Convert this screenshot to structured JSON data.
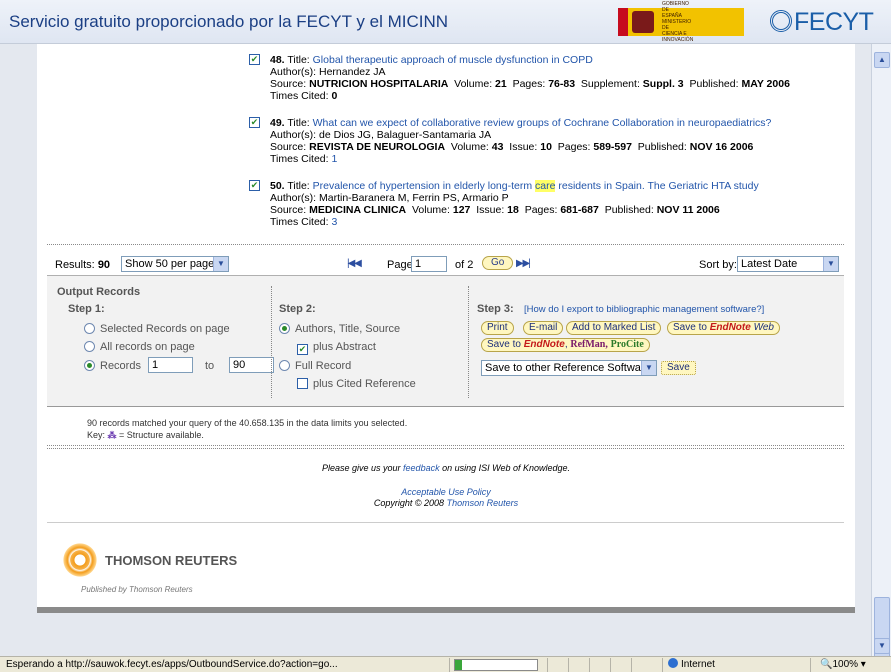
{
  "header": {
    "site_title": "Servicio gratuito proporcionado por la FECYT y el MICINN",
    "gov_logo_text": "GOBIERNO DE ESPAÑA  MINISTERIO DE CIENCIA E INNOVACIÓN",
    "fecyt_logo": "FECYT"
  },
  "records": [
    {
      "number": "48.",
      "title_label": "Title:",
      "title": "Global therapeutic approach of muscle dysfunction in COPD",
      "authors": "Author(s): Hernandez JA",
      "source_label": "Source:",
      "source": "NUTRICION HOSPITALARIA",
      "volume_label": "Volume:",
      "volume": "21",
      "issue_label": "",
      "issue": "",
      "pages_label": "Pages:",
      "pages": "76-83",
      "supplement_label": "Supplement:",
      "supplement": "Suppl. 3",
      "published_label": "Published:",
      "published": "MAY 2006",
      "times_cited_label": "Times Cited:",
      "times_cited": "0",
      "checked": true
    },
    {
      "number": "49.",
      "title_label": "Title:",
      "title": "What can we expect of collaborative review groups of Cochrane Collaboration in neuropaediatrics?",
      "authors": "Author(s): de Dios JG, Balaguer-Santamaria JA",
      "source_label": "Source:",
      "source": "REVISTA DE NEUROLOGIA",
      "volume_label": "Volume:",
      "volume": "43",
      "issue_label": "Issue:",
      "issue": "10",
      "pages_label": "Pages:",
      "pages": "589-597",
      "published_label": "Published:",
      "published": "NOV 16 2006",
      "times_cited_label": "Times Cited:",
      "times_cited": "1",
      "checked": true
    },
    {
      "number": "50.",
      "title_label": "Title:",
      "title_part1": "Prevalence of hypertension in elderly long-term ",
      "title_highlight": "care",
      "title_part2": " residents in Spain. The Geriatric HTA study",
      "authors": "Author(s): Martin-Baranera M, Ferrin PS, Armario P",
      "source_label": "Source:",
      "source": "MEDICINA CLINICA",
      "volume_label": "Volume:",
      "volume": "127",
      "issue_label": "Issue:",
      "issue": "18",
      "pages_label": "Pages:",
      "pages": "681-687",
      "published_label": "Published:",
      "published": "NOV 11 2006",
      "times_cited_label": "Times Cited:",
      "times_cited": "3",
      "checked": true
    }
  ],
  "pagination": {
    "results_label": "Results:",
    "results_count": "90",
    "per_page": "Show 50 per page",
    "page_label": "Page",
    "page_value": "1",
    "of_label": "of 2",
    "go_label": "Go",
    "sort_label": "Sort by:",
    "sort_value": "Latest Date"
  },
  "output": {
    "header": "Output Records",
    "step1": {
      "label": "Step 1:",
      "opt_selected": "Selected Records on page",
      "opt_all": "All records on page",
      "opt_records": "Records",
      "from": "1",
      "to_label": "to",
      "to": "90"
    },
    "step2": {
      "label": "Step 2:",
      "opt_ats": "Authors, Title, Source",
      "plus_abstract": "plus Abstract",
      "opt_full": "Full Record",
      "plus_cited": "plus Cited Reference"
    },
    "step3": {
      "label": "Step 3:",
      "help_link": "[How do I export to bibliographic management software?]",
      "print": "Print",
      "email": "E-mail",
      "add_marked": "Add to Marked List",
      "save_to": "Save to",
      "endnote": "EndNote",
      "web": "Web",
      "save_to2": "Save to",
      "refman": "RefMan,",
      "procite": "ProCite",
      "other_software": "Save to other Reference Software",
      "save": "Save"
    }
  },
  "footer": {
    "matched": "90 records matched your query of the 40.658.135 in the data limits you selected.",
    "key": "Key:",
    "key_desc": "= Structure available.",
    "feedback_pre": "Please give us your",
    "feedback_link": "feedback",
    "feedback_post": "on using ISI Web of Knowledge.",
    "aup": "Acceptable Use Policy",
    "copyright": "Copyright © 2008",
    "copyright_link": "Thomson Reuters",
    "tr_name": "THOMSON REUTERS",
    "tr_pub": "Published by Thomson Reuters"
  },
  "statusbar": {
    "text": "Esperando a http://sauwok.fecyt.es/apps/OutboundService.do?action=go...",
    "zone": "Internet",
    "zoom": "100%",
    "progress": 0.08
  }
}
